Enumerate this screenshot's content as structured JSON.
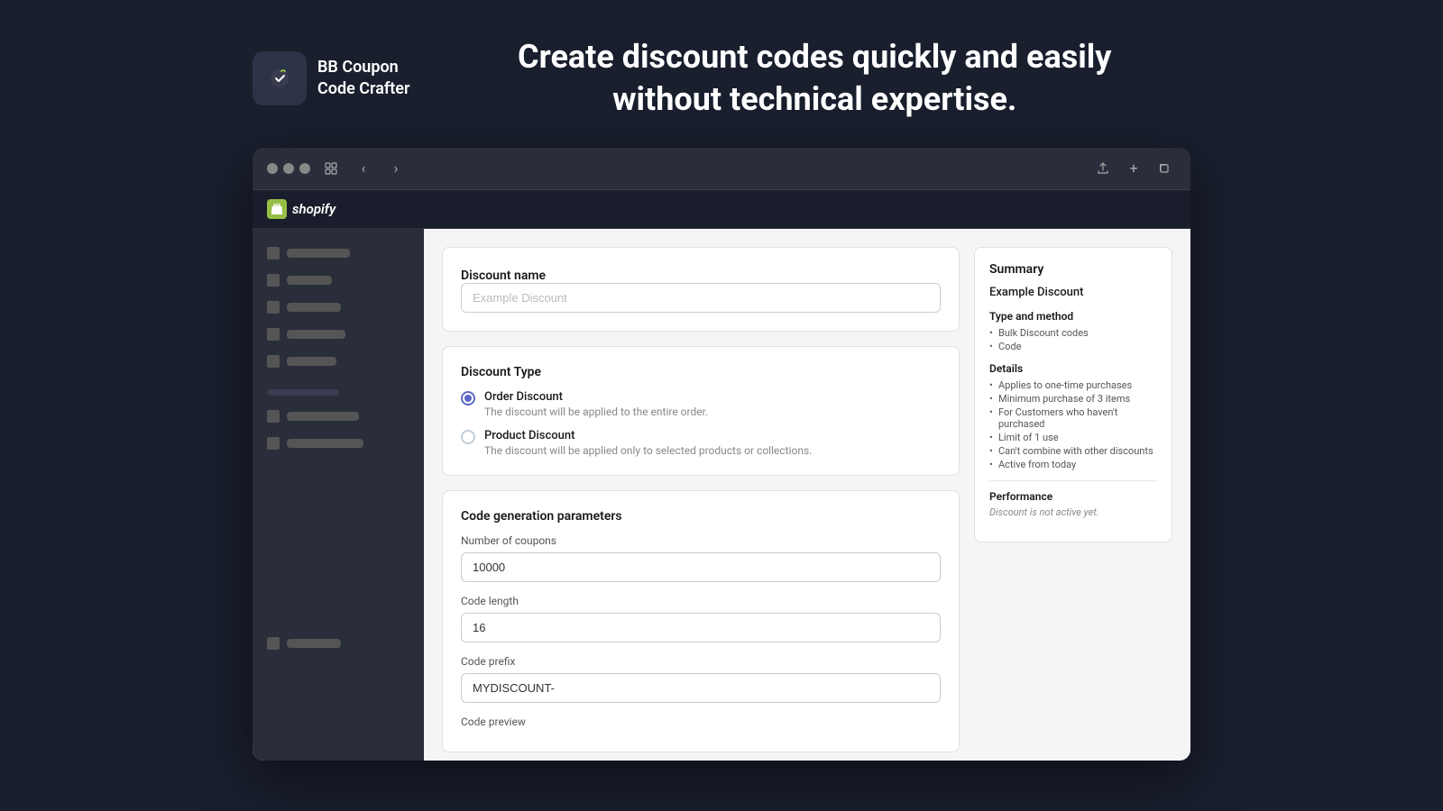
{
  "header": {
    "logo_icon": "🏷",
    "logo_line1": "BB Coupon",
    "logo_line2": "Code Crafter",
    "tagline_line1": "Create discount codes quickly and easily",
    "tagline_line2": "without technical expertise."
  },
  "browser": {
    "nav_back": "‹",
    "nav_forward": "›",
    "icon_share": "⬆",
    "icon_plus": "+",
    "icon_copy": "❒",
    "icon_tabs": "⊞"
  },
  "shopify": {
    "logo_text": "shopify",
    "icon_text": "S"
  },
  "sidebar": {
    "items": [
      {
        "label_width": "70px"
      },
      {
        "label_width": "50px"
      },
      {
        "label_width": "60px"
      },
      {
        "label_width": "65px"
      },
      {
        "label_width": "55px"
      }
    ],
    "sections": [
      {
        "label_width": "80px"
      },
      {
        "label_width": "85px"
      }
    ],
    "bottom_item": {
      "label_width": "60px"
    }
  },
  "discount_name": {
    "label": "Discount name",
    "placeholder": "Example Discount",
    "value": ""
  },
  "discount_type": {
    "title": "Discount Type",
    "options": [
      {
        "id": "order",
        "label": "Order Discount",
        "description": "The discount will be applied to the entire order.",
        "selected": true
      },
      {
        "id": "product",
        "label": "Product Discount",
        "description": "The discount will be applied only to selected products or collections.",
        "selected": false
      }
    ]
  },
  "code_generation": {
    "title": "Code generation parameters",
    "fields": [
      {
        "label": "Number of coupons",
        "value": "10000",
        "placeholder": ""
      },
      {
        "label": "Code length",
        "value": "16",
        "placeholder": ""
      },
      {
        "label": "Code prefix",
        "value": "MYDISCOUNT-",
        "placeholder": ""
      },
      {
        "label": "Code preview",
        "value": "",
        "placeholder": ""
      }
    ]
  },
  "summary": {
    "title": "Summary",
    "discount_name": "Example Discount",
    "type_method_title": "Type and method",
    "type_method_items": [
      "Bulk Discount codes",
      "Code"
    ],
    "details_title": "Details",
    "details_items": [
      "Applies to one-time purchases",
      "Minimum purchase of 3 items",
      "For Customers who haven't purchased",
      "Limit of 1 use",
      "Can't combine with other discounts",
      "Active from today"
    ],
    "performance_title": "Performance",
    "performance_text": "Discount is not active yet."
  }
}
